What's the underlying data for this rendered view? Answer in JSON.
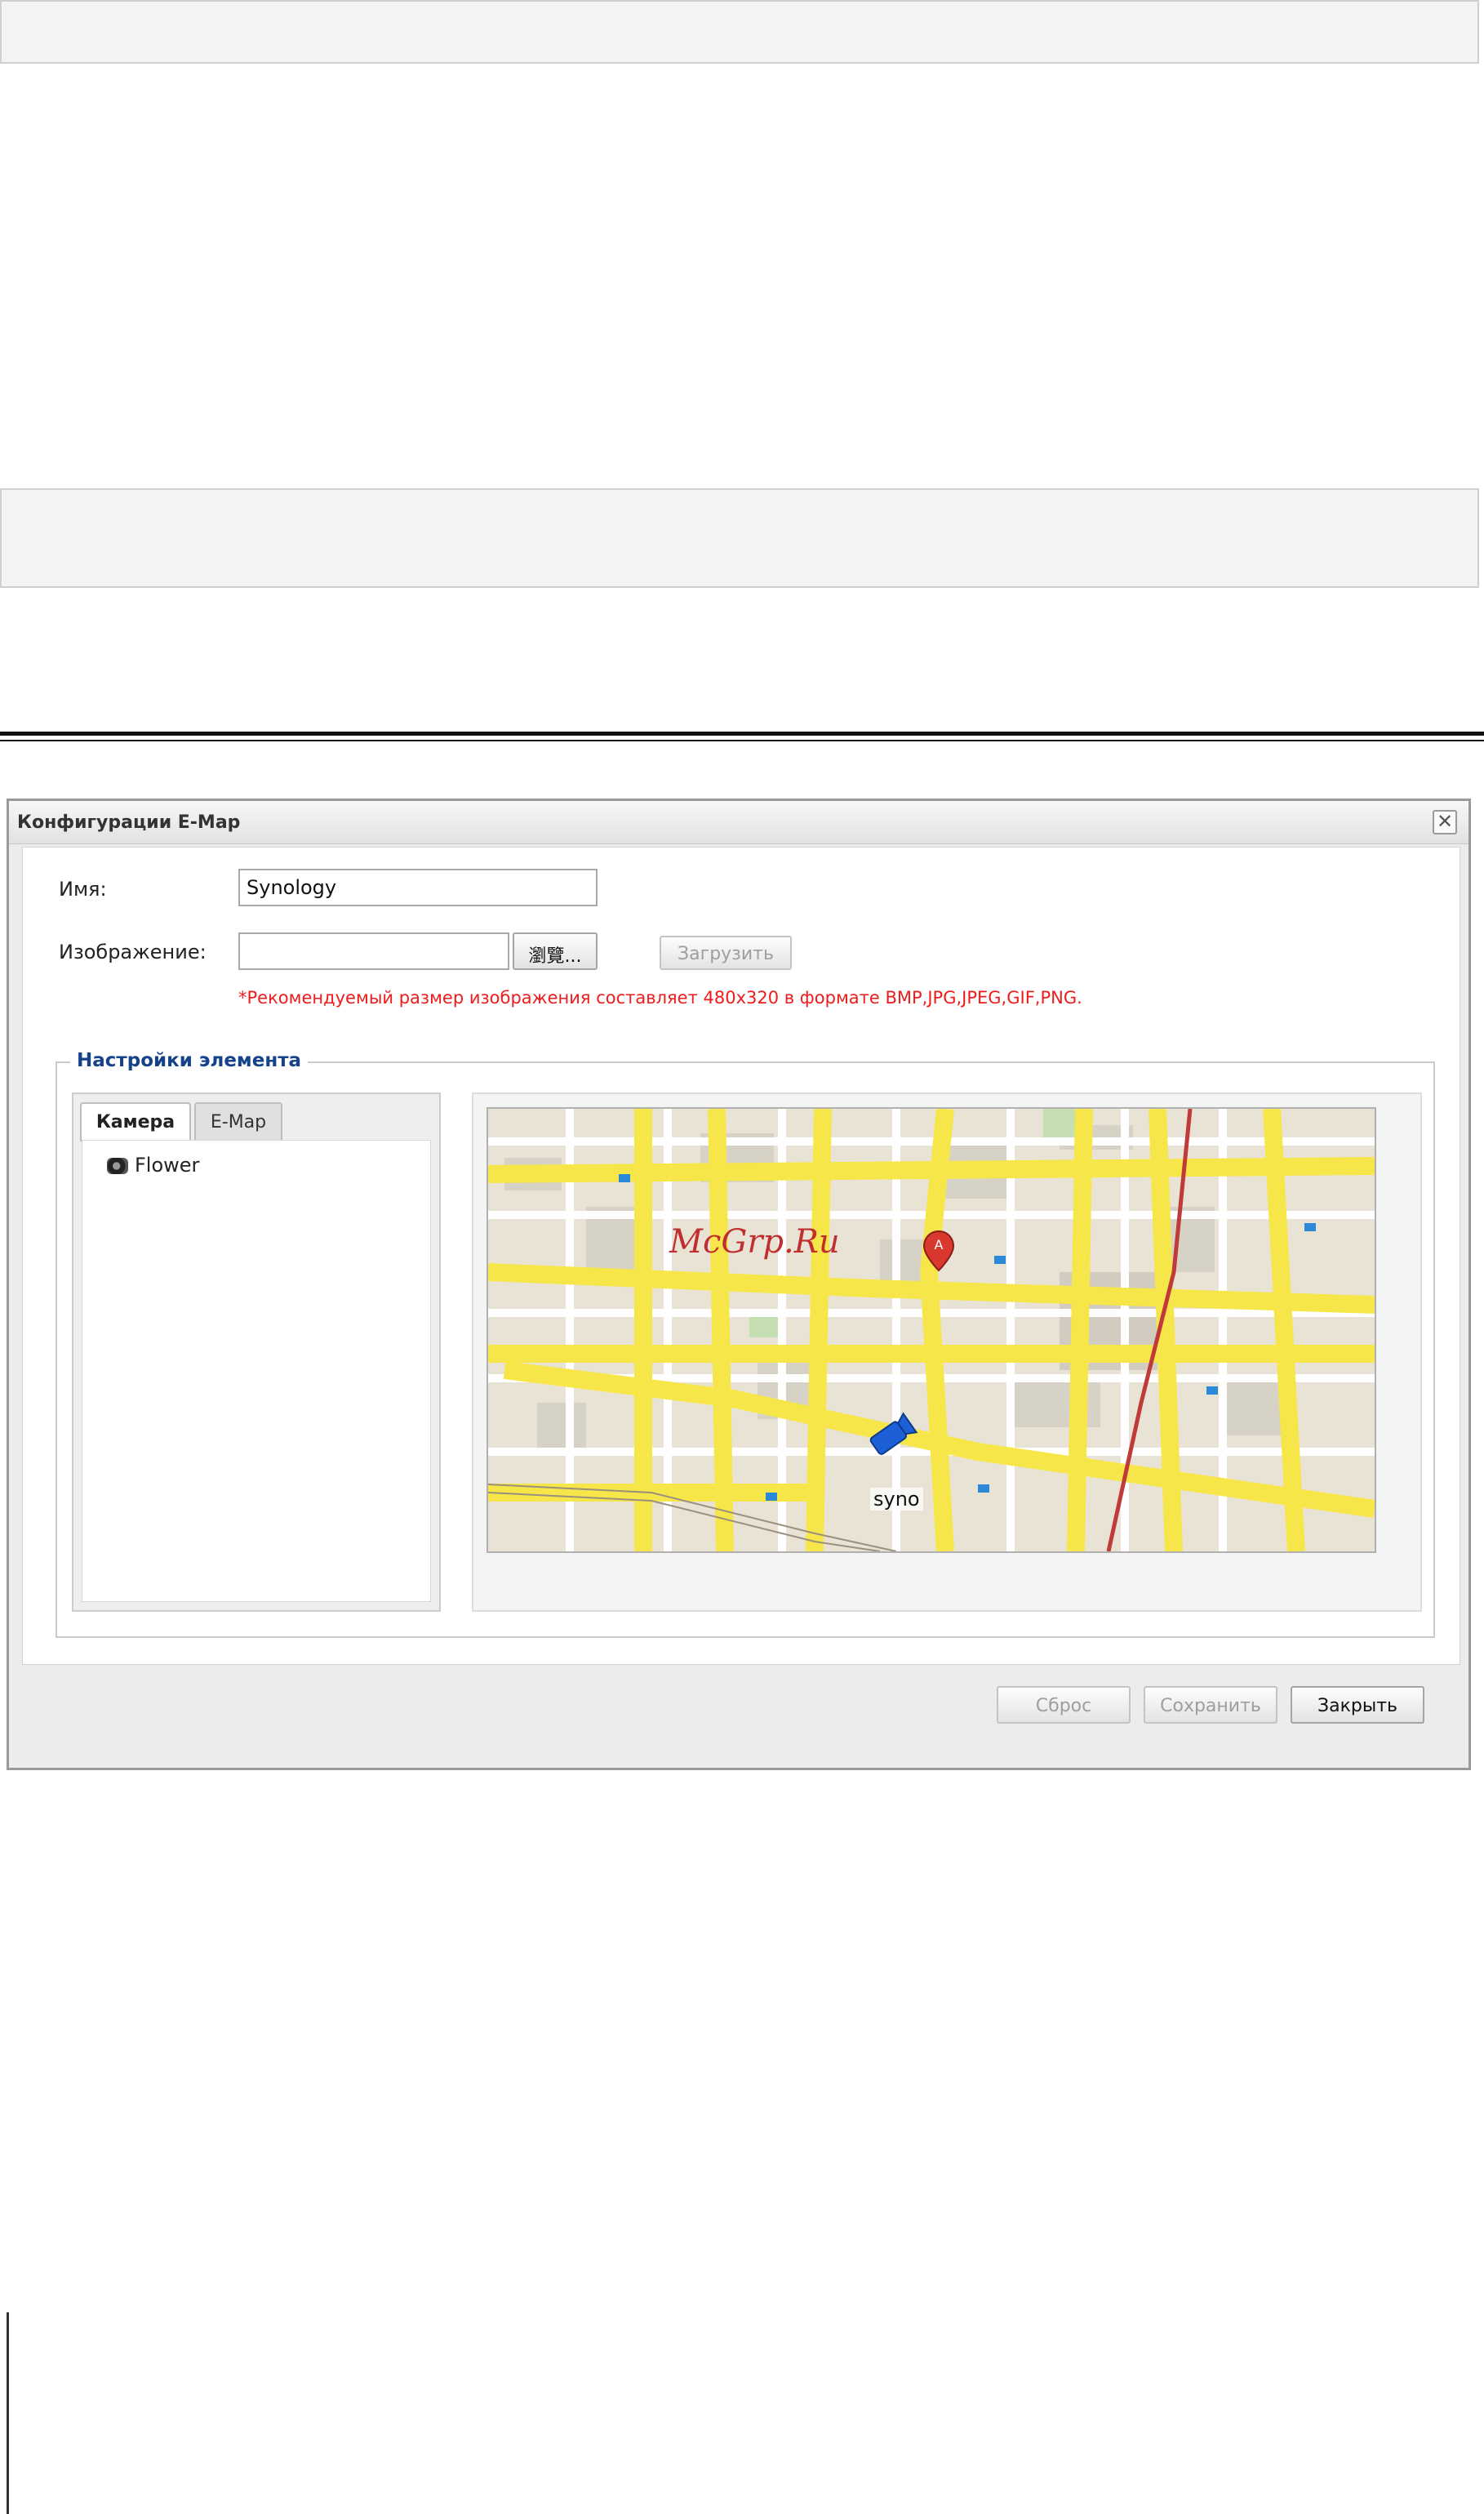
{
  "dialog": {
    "title": "Конфигурации E-Map",
    "close_symbol": "✕",
    "form": {
      "name_label": "Имя:",
      "name_value": "Synology",
      "image_label": "Изображение:",
      "image_value": "",
      "browse_label": "瀏覽...",
      "upload_label": "Загрузить",
      "hint": "*Рекомендуемый размер изображения составляет 480x320 в формате BMP,JPG,JPEG,GIF,PNG."
    },
    "element_settings": {
      "legend": "Настройки элемента",
      "tabs": [
        {
          "label": "Камера",
          "active": true
        },
        {
          "label": "E-Map",
          "active": false
        }
      ],
      "tree_items": [
        {
          "label": "Flower",
          "icon": "camera-icon"
        }
      ]
    },
    "map": {
      "watermark": "McGrp.Ru",
      "camera_label": "syno",
      "marker_letter": "A",
      "marker_icon": "map-pin-icon",
      "camera_icon": "camera-marker-icon"
    },
    "footer": {
      "reset_label": "Сброс",
      "save_label": "Сохранить",
      "close_label": "Закрыть"
    }
  },
  "colors": {
    "hint": "#ee1c1c",
    "legend": "#15428b",
    "road": "#f7e64a",
    "marker": "#d9382e",
    "camera_marker": "#1c5fd6"
  }
}
